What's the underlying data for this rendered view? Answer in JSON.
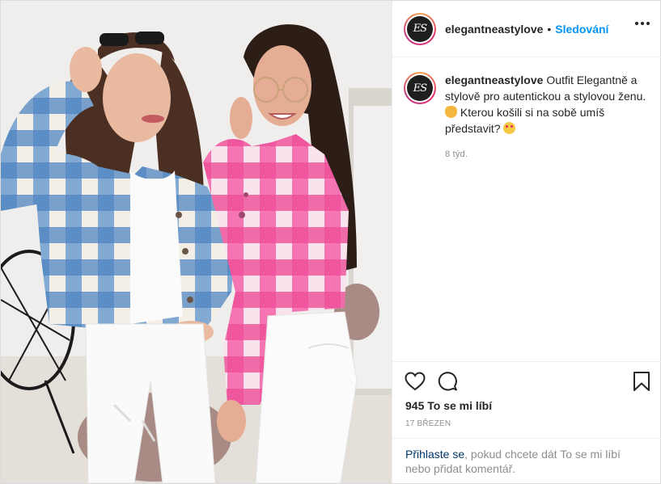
{
  "post": {
    "username": "elegantneastylove",
    "avatar_text": "ES",
    "follow_label": "Sledování",
    "separator": "•",
    "more_icon": "more-horizontal-icon"
  },
  "caption": {
    "username": "elegantneastylove",
    "text_part1": "Outfit Elegantně a stylově pro autentickou a stylovou ženu.",
    "emoji1": "ok-hand-emoji",
    "text_part2": "Kterou košili si na sobě umíš představit?",
    "emoji2": "smiling-hearts-emoji",
    "time": "8 týd."
  },
  "actions": {
    "like_icon": "heart-icon",
    "comment_icon": "comment-icon",
    "save_icon": "bookmark-icon"
  },
  "likes": "945 To se mi líbí",
  "date": "17 BŘEZEN",
  "login": {
    "link_label": "Přihlaste se",
    "rest_text": ", pokud chcete dát To se mi líbí nebo přidat komentář."
  },
  "colors": {
    "follow": "#0095f6",
    "link": "#00376b",
    "muted": "#8e8e8e",
    "text": "#262626",
    "jacket_blue": "#5b8fc7",
    "jacket_pink": "#f25ea5"
  }
}
